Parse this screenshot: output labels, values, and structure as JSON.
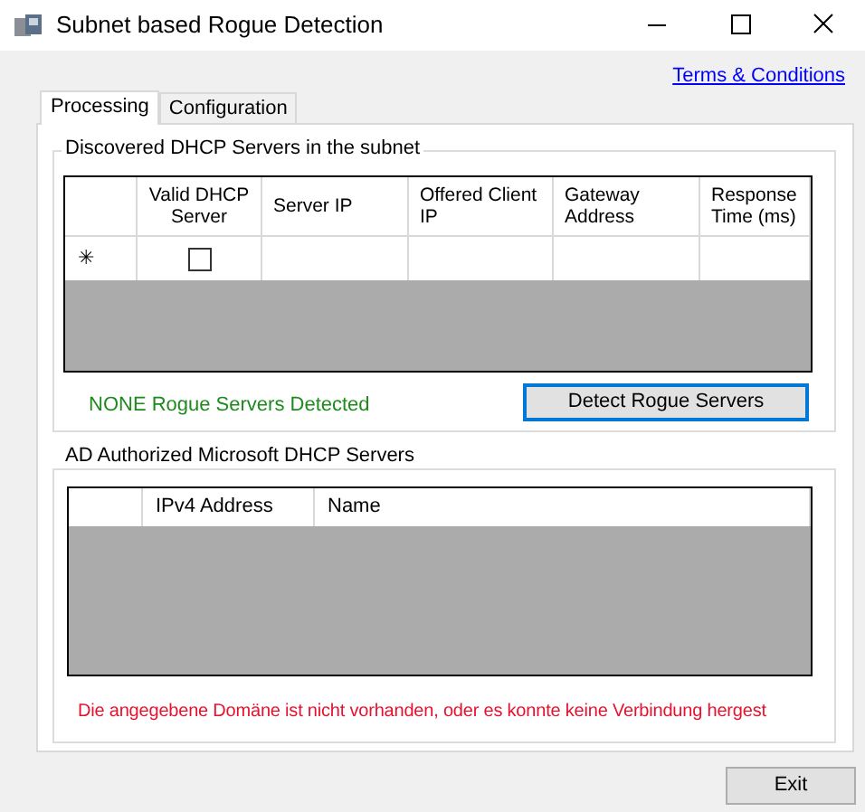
{
  "window": {
    "title": "Subnet based Rogue Detection"
  },
  "terms_link": "Terms & Conditions",
  "tabs": [
    {
      "label": "Processing",
      "selected": true
    },
    {
      "label": "Configuration",
      "selected": false
    }
  ],
  "discovered_group": {
    "title": "Discovered DHCP Servers in the subnet",
    "columns": [
      "Valid DHCP Server",
      "Server IP",
      "Offered Client IP",
      "Gateway Address",
      "Response Time (ms)"
    ],
    "new_row": {
      "marker": "✳",
      "checked": false
    },
    "status": "NONE Rogue Servers Detected",
    "button": "Detect Rogue Servers"
  },
  "authorized_group": {
    "title": "AD Authorized Microsoft DHCP Servers",
    "columns": [
      "IPv4 Address",
      "Name"
    ],
    "error": "Die angegebene Domäne ist nicht vorhanden, oder es konnte keine Verbindung hergest"
  },
  "buttons": [
    "Exit"
  ]
}
